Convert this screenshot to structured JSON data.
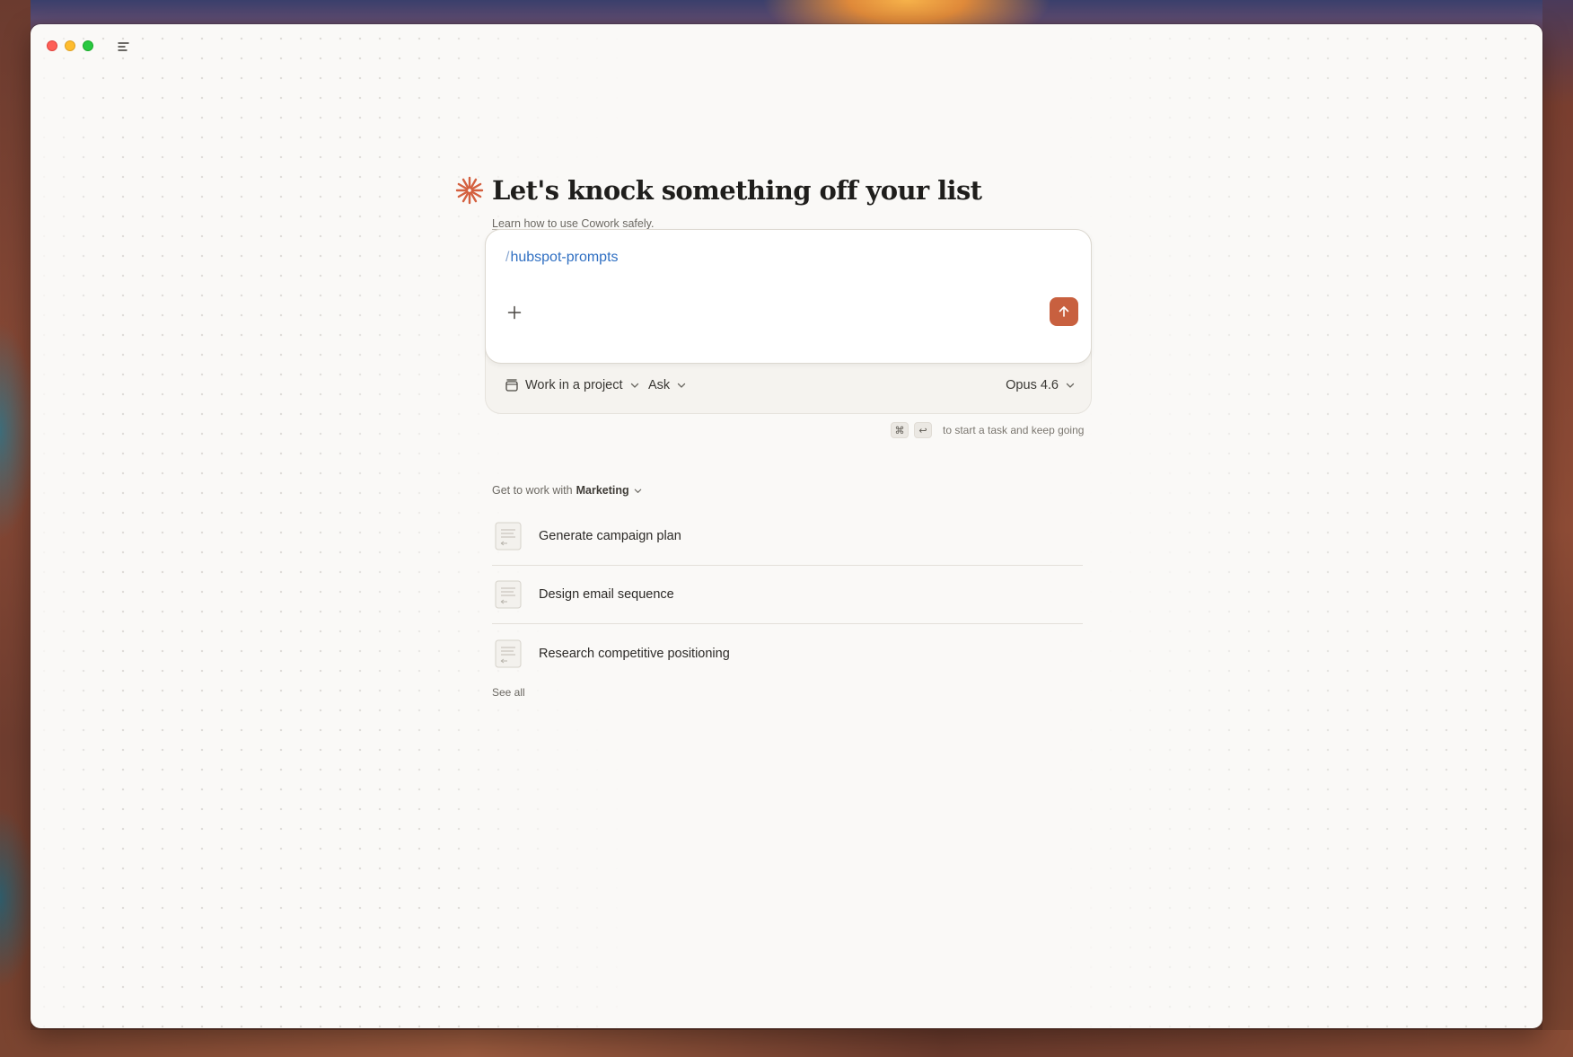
{
  "app": {
    "title": "Cowork"
  },
  "hero": {
    "title": "Let's knock something off your list",
    "learn_link": "Learn how to use Cowork safely.",
    "accent_color": "#d4603f"
  },
  "composer": {
    "slash": "/",
    "command": "hubspot-prompts",
    "send_color": "#c8603f"
  },
  "composer_bar": {
    "project_label": "Work in a project",
    "mode_label": "Ask",
    "model_label": "Opus 4.6"
  },
  "hint": {
    "key1": "⌘",
    "key2": "↩",
    "text": "to start a task and keep going"
  },
  "suggestions": {
    "prefix": "Get to work with",
    "category": "Marketing",
    "items": [
      {
        "label": "Generate campaign plan",
        "icon": "document-icon"
      },
      {
        "label": "Design email sequence",
        "icon": "document-icon"
      },
      {
        "label": "Research competitive positioning",
        "icon": "document-icon"
      }
    ],
    "see_all": "See all"
  }
}
